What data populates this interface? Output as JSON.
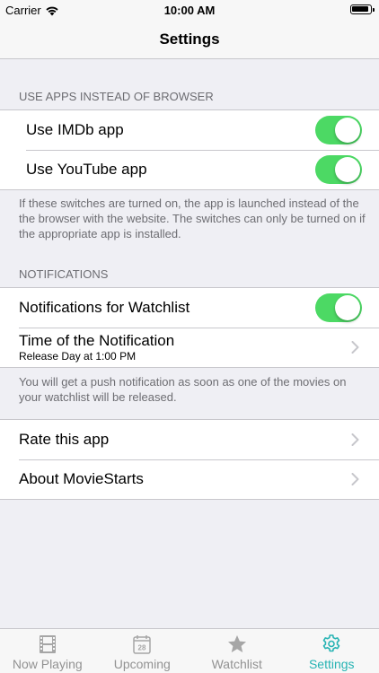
{
  "status_bar": {
    "carrier": "Carrier",
    "time": "10:00 AM"
  },
  "nav": {
    "title": "Settings"
  },
  "apps_section": {
    "header": "USE APPS INSTEAD OF BROWSER",
    "items": [
      {
        "label": "Use IMDb app",
        "on": true
      },
      {
        "label": "Use YouTube app",
        "on": true
      }
    ],
    "footer": "If these switches are turned on, the app is launched instead of the the browser with the website. The switches can only be turned on if the appropriate app is installed."
  },
  "notifications_section": {
    "header": "NOTIFICATIONS",
    "watchlist_label": "Notifications for Watchlist",
    "watchlist_on": true,
    "time_label": "Time of the Notification",
    "time_value": "Release Day at 1:00 PM",
    "footer": "You will get a push notification as soon as one of the movies on your watchlist will be released."
  },
  "misc_section": {
    "rate_label": "Rate this app",
    "about_label": "About MovieStarts"
  },
  "tab_bar": {
    "tabs": [
      {
        "label": "Now Playing",
        "icon": "film-icon"
      },
      {
        "label": "Upcoming",
        "icon": "calendar-icon",
        "day": "28"
      },
      {
        "label": "Watchlist",
        "icon": "star-icon"
      },
      {
        "label": "Settings",
        "icon": "gear-icon"
      }
    ],
    "active": "Settings"
  },
  "colors": {
    "toggle_on": "#4cd964",
    "tab_active": "#26b3b3",
    "tab_inactive": "#929292",
    "background": "#efeff4"
  }
}
